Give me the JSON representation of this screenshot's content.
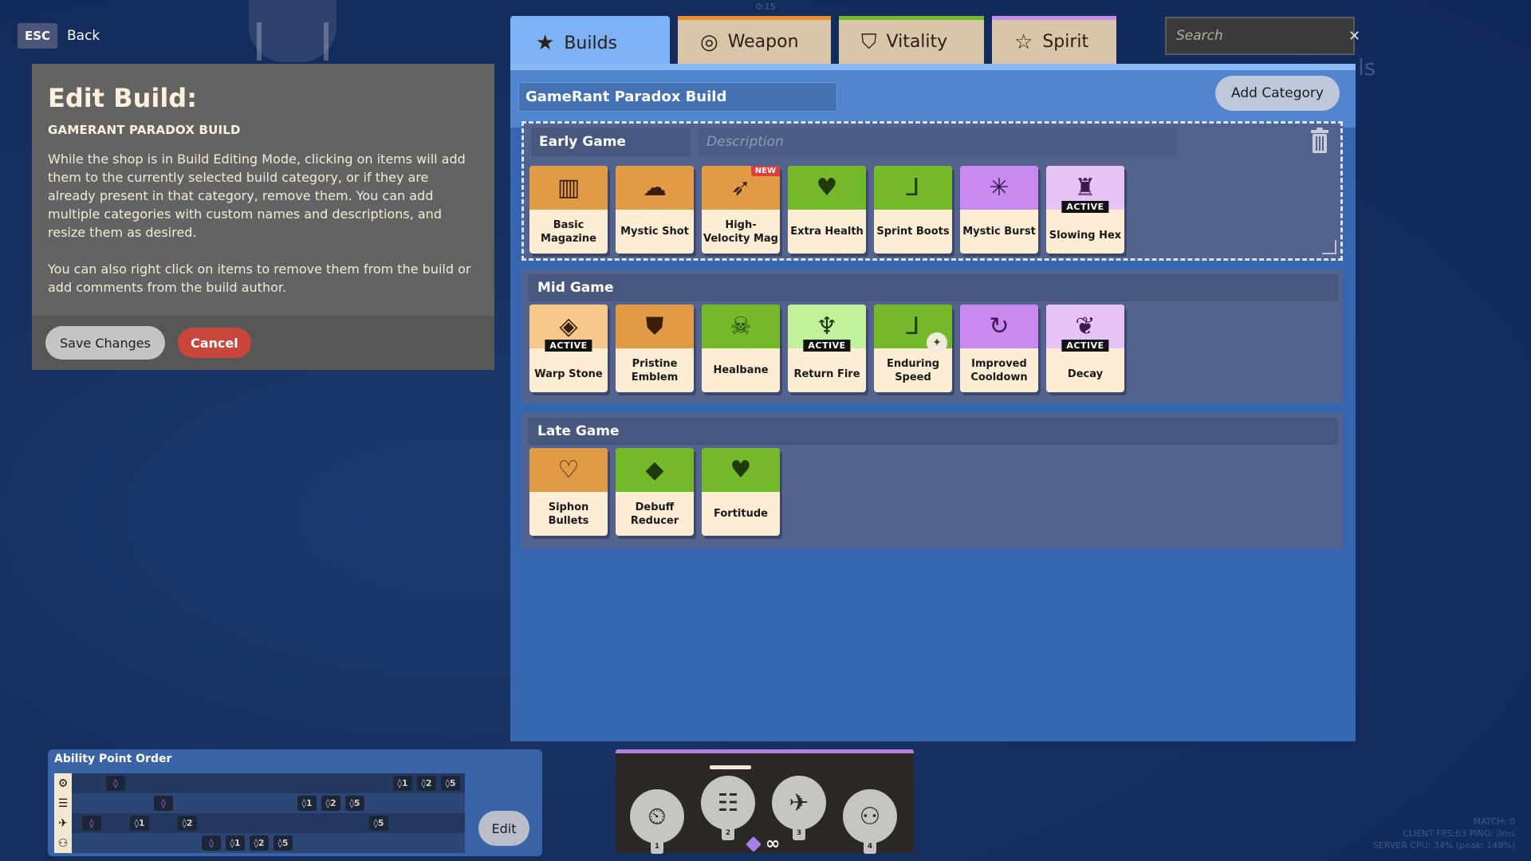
{
  "nav": {
    "esc_key": "ESC",
    "back_label": "Back"
  },
  "background": {
    "timer": "0:15",
    "ghost_text": "ls"
  },
  "edit_panel": {
    "title": "Edit Build:",
    "build_name_upper": "GAMERANT PARADOX BUILD",
    "description_1": "While the shop is in Build Editing Mode, clicking on items will add them to the currently selected build category, or if they are already present in that category, remove them. You can add multiple categories with custom names and descriptions, and resize them as desired.",
    "description_2": "You can also right click on items to remove them from the build or add comments from the build author.",
    "save_label": "Save Changes",
    "cancel_label": "Cancel"
  },
  "tabs": [
    {
      "label": "Builds",
      "icon": "star-icon",
      "active": true
    },
    {
      "label": "Weapon",
      "icon": "weapon-ring-icon",
      "color": "#e8912d"
    },
    {
      "label": "Vitality",
      "icon": "vitality-shield-icon",
      "color": "#6fbc2a"
    },
    {
      "label": "Spirit",
      "icon": "spirit-star-icon",
      "color": "#c88cf0"
    }
  ],
  "search": {
    "placeholder": "Search",
    "value": ""
  },
  "shop": {
    "build_name": "GameRant Paradox Build",
    "add_category_label": "Add Category",
    "categories": [
      {
        "name": "Early Game",
        "description_placeholder": "Description",
        "selected": true,
        "items": [
          {
            "name": "Basic Magazine",
            "type": "weapon",
            "icon": "magazine-icon"
          },
          {
            "name": "Mystic Shot",
            "type": "weapon",
            "icon": "mystic-shot-icon"
          },
          {
            "name": "High-Velocity Mag",
            "type": "weapon",
            "icon": "bullet-icon",
            "badge": "NEW"
          },
          {
            "name": "Extra Health",
            "type": "vitality",
            "icon": "heart-icon"
          },
          {
            "name": "Sprint Boots",
            "type": "vitality",
            "icon": "boot-icon"
          },
          {
            "name": "Mystic Burst",
            "type": "spirit",
            "icon": "burst-icon"
          },
          {
            "name": "Slowing Hex",
            "type": "spirit",
            "icon": "hex-icon",
            "badge": "ACTIVE"
          }
        ]
      },
      {
        "name": "Mid Game",
        "items": [
          {
            "name": "Warp Stone",
            "type": "weapon",
            "icon": "crystal-icon",
            "badge": "ACTIVE"
          },
          {
            "name": "Pristine Emblem",
            "type": "weapon",
            "icon": "emblem-shield-icon"
          },
          {
            "name": "Healbane",
            "type": "vitality",
            "icon": "skull-icon"
          },
          {
            "name": "Return Fire",
            "type": "vitality",
            "icon": "return-fire-icon",
            "badge": "ACTIVE"
          },
          {
            "name": "Enduring Speed",
            "type": "vitality",
            "icon": "winged-boot-icon"
          },
          {
            "name": "Improved Cooldown",
            "type": "spirit",
            "icon": "cooldown-icon"
          },
          {
            "name": "Decay",
            "type": "spirit",
            "icon": "decay-heart-icon",
            "badge": "ACTIVE"
          }
        ]
      },
      {
        "name": "Late Game",
        "items": [
          {
            "name": "Siphon Bullets",
            "type": "weapon",
            "icon": "siphon-heart-icon"
          },
          {
            "name": "Debuff Reducer",
            "type": "vitality",
            "icon": "debuff-icon"
          },
          {
            "name": "Fortitude",
            "type": "vitality",
            "icon": "sparkle-heart-icon"
          }
        ]
      }
    ]
  },
  "ability_point_order": {
    "title": "Ability Point Order",
    "edit_label": "Edit",
    "rows": [
      {
        "ability": "ability-1",
        "chips": [
          "◊",
          "◊1",
          "◊2",
          "◊5"
        ]
      },
      {
        "ability": "ability-2",
        "chips": [
          "◊",
          "◊1",
          "◊2",
          "◊5"
        ]
      },
      {
        "ability": "ability-3",
        "chips": [
          "◊",
          "◊1",
          "◊2",
          "◊5"
        ]
      },
      {
        "ability": "ability-4",
        "chips": [
          "◊",
          "◊1",
          "◊2",
          "◊5"
        ]
      }
    ]
  },
  "ability_bar": {
    "abilities": [
      {
        "slot": "1",
        "icon": "clock-gear-icon"
      },
      {
        "slot": "2",
        "icon": "striped-clock-icon",
        "selected": true
      },
      {
        "slot": "3",
        "icon": "rifle-icon"
      },
      {
        "slot": "4",
        "icon": "swap-people-icon"
      }
    ],
    "points": "∞"
  },
  "stats": {
    "match": "MATCH: 0",
    "client": "CLIENT FPS:83   PING: 0ms",
    "server": "SERVER CPU: 34% (peak: 149%)"
  }
}
